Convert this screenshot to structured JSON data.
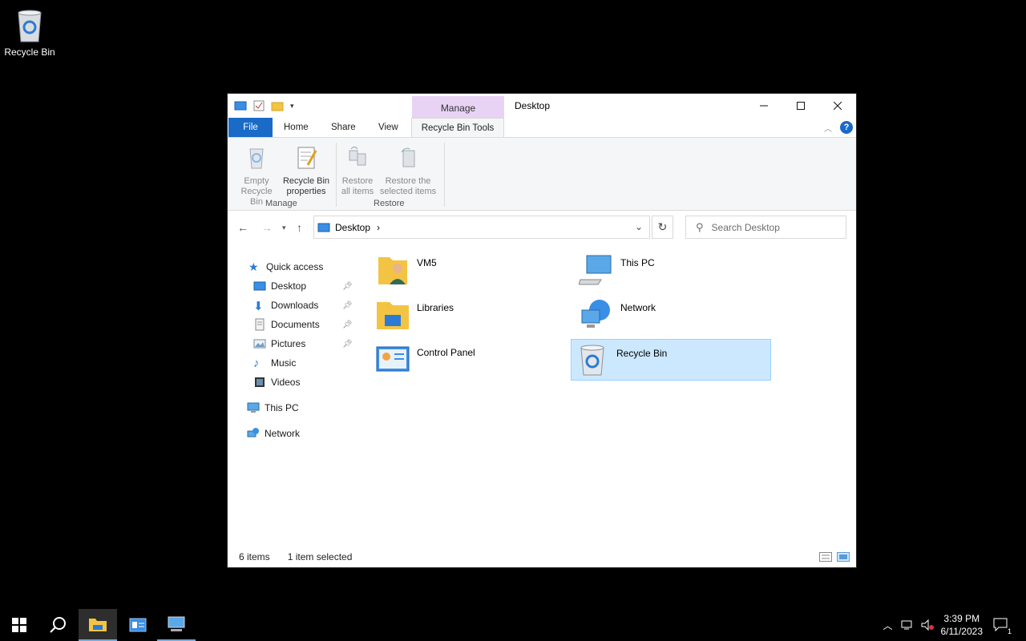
{
  "desktop": {
    "recycle_bin_label": "Recycle Bin"
  },
  "window": {
    "title": "Desktop",
    "context_tab_group": "Manage",
    "tabs": [
      "File",
      "Home",
      "Share",
      "View",
      "Recycle Bin Tools"
    ],
    "ribbon": {
      "manage_group_label": "Manage",
      "restore_group_label": "Restore",
      "empty_recycle_bin": [
        "Empty",
        "Recycle Bin"
      ],
      "recycle_bin_properties": [
        "Recycle Bin",
        "properties"
      ],
      "restore_all_items": [
        "Restore",
        "all items"
      ],
      "restore_selected_items": [
        "Restore the",
        "selected items"
      ]
    },
    "address": {
      "crumb": "Desktop",
      "separator": "›"
    },
    "search": {
      "placeholder": "Search Desktop"
    },
    "nav_pane": {
      "quick_access": "Quick access",
      "items": [
        "Desktop",
        "Downloads",
        "Documents",
        "Pictures",
        "Music",
        "Videos"
      ],
      "this_pc": "This PC",
      "network": "Network"
    },
    "files": [
      "VM5",
      "This PC",
      "Libraries",
      "Network",
      "Control Panel",
      "Recycle Bin"
    ],
    "status": {
      "count": "6 items",
      "selected": "1 item selected"
    }
  },
  "taskbar": {
    "time": "3:39 PM",
    "date": "6/11/2023",
    "notification_count": "1"
  },
  "colors": {
    "accent": "#1a6ac8",
    "selection": "#cce8ff",
    "manage_tab": "#e8d3f5"
  }
}
